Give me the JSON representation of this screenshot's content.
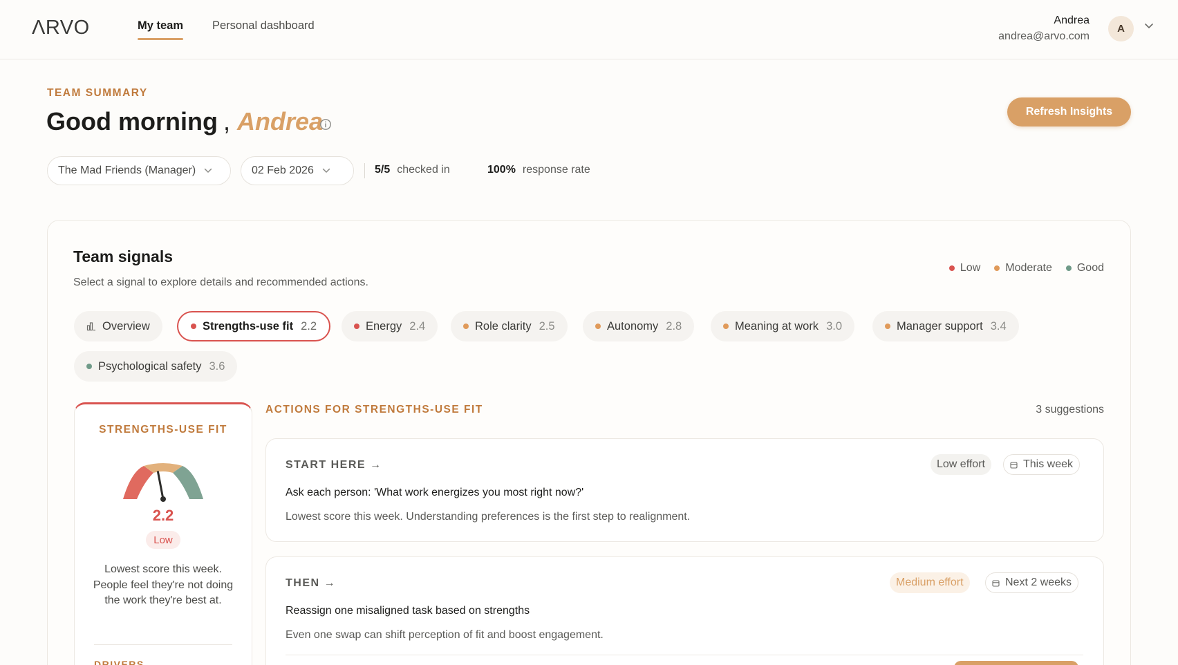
{
  "nav": {
    "logo": "ΛRVO",
    "tabs": [
      "My team",
      "Personal dashboard"
    ],
    "user": {
      "name": "Andrea",
      "email": "andrea@arvo.com",
      "initial": "A"
    }
  },
  "header": {
    "eyebrow": "TEAM SUMMARY",
    "greeting": "Good morning",
    "comma": ",",
    "name": "Andrea",
    "refresh_label": "Refresh Insights",
    "team_select": "The Mad Friends (Manager)",
    "date_select": "02 Feb 2026",
    "checked_in_value": "5/5",
    "checked_in_label": "checked in",
    "response_value": "100%",
    "response_label": "response rate"
  },
  "signals": {
    "title": "Team signals",
    "subtitle": "Select a signal to explore details and recommended actions.",
    "legend": [
      "Low",
      "Moderate",
      "Good"
    ],
    "overview_label": "Overview",
    "chips": [
      {
        "label": "Strengths-use fit",
        "score": "2.2",
        "level": "low"
      },
      {
        "label": "Energy",
        "score": "2.4",
        "level": "low"
      },
      {
        "label": "Role clarity",
        "score": "2.5",
        "level": "moderate"
      },
      {
        "label": "Autonomy",
        "score": "2.8",
        "level": "moderate"
      },
      {
        "label": "Meaning at work",
        "score": "3.0",
        "level": "moderate"
      },
      {
        "label": "Manager support",
        "score": "3.4",
        "level": "moderate"
      },
      {
        "label": "Psychological safety",
        "score": "3.6",
        "level": "good"
      }
    ],
    "colors": {
      "low": "#d9534f",
      "moderate": "#e09a5a",
      "good": "#6f9a88",
      "accent": "#d9a066"
    }
  },
  "detail": {
    "title": "STRENGTHS-USE FIT",
    "score": "2.2",
    "score_value": 2.2,
    "score_max": 5,
    "level": "Low",
    "description": "Lowest score this week. People feel they're not doing the work they're best at.",
    "drivers_label": "DRIVERS"
  },
  "actions": {
    "title": "ACTIONS FOR STRENGTHS-USE FIT",
    "count": "3 suggestions",
    "items": [
      {
        "step": "START HERE →",
        "effort": "Low effort",
        "timing": "This week",
        "title": "Ask each person: 'What work energizes you most right now?'",
        "detail": "Lowest score this week. Understanding preferences is the first step to realignment."
      },
      {
        "step": "THEN →",
        "effort": "Medium effort",
        "timing": "Next 2 weeks",
        "title": "Reassign one misaligned task based on strengths",
        "detail": "Even one swap can shift perception of fit and boost engagement."
      }
    ]
  }
}
